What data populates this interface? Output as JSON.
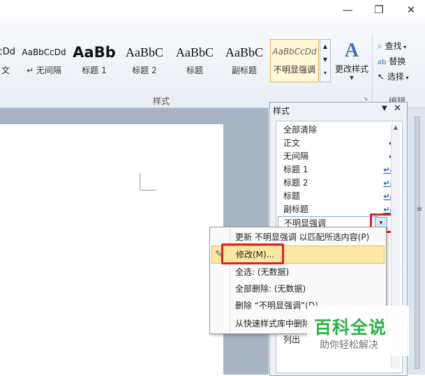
{
  "window": {
    "minimize_glyph": "—",
    "restore_glyph": "❐",
    "close_glyph": "✕",
    "ribbon_collapse_glyph": "⌃",
    "help_glyph": "?"
  },
  "ribbon": {
    "gallery": [
      {
        "preview": "cDd",
        "label": "文"
      },
      {
        "preview": "AaBbCcDd",
        "label": "↵ 无间隔"
      },
      {
        "preview": "AaBb",
        "label": "标题 1"
      },
      {
        "preview": "AaBbC",
        "label": "标题 2"
      },
      {
        "preview": "AaBbC",
        "label": "标题"
      },
      {
        "preview": "AaBbC",
        "label": "副标题"
      },
      {
        "preview": "AaBbCcDd",
        "label": "不明显强调"
      }
    ],
    "change_styles": "更改样式",
    "group_styles": "样式",
    "find": "查找",
    "replace": "替换",
    "select": "选择",
    "group_edit": "编辑"
  },
  "pane": {
    "title": "样式",
    "items": [
      {
        "name": "全部清除",
        "mark": ""
      },
      {
        "name": "正文",
        "mark": "↵"
      },
      {
        "name": "无间隔",
        "mark": "↵"
      },
      {
        "name": "标题 1",
        "mark": "↵a"
      },
      {
        "name": "标题 2",
        "mark": "↵a"
      },
      {
        "name": "标题",
        "mark": "↵a"
      },
      {
        "name": "副标题",
        "mark": "↵a"
      },
      {
        "name": "不明显强调",
        "mark": ""
      }
    ],
    "partial_item": "列出"
  },
  "menu": {
    "update": "更新 不明显强调 以匹配所选内容(P)",
    "modify": "修改(M)...",
    "select_all": "全选: (无数据)",
    "delete_all": "全部删除: (无数据)",
    "delete": "删除 “不明显强调”(D)...",
    "remove_gallery": "从快速样式库中删除"
  },
  "watermark": {
    "title": "百科全说",
    "subtitle": "助你轻松解决"
  }
}
